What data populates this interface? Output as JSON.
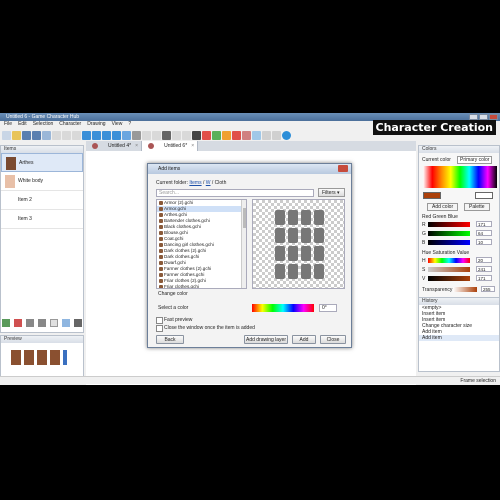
{
  "window": {
    "title": "Untitled 6 - Game Character Hub"
  },
  "brand": {
    "title": "Character Creation"
  },
  "menu": [
    "File",
    "Edit",
    "Selection",
    "Character",
    "Drawing",
    "View",
    "?"
  ],
  "items_panel": {
    "title": "Items",
    "items": [
      {
        "label": "Arthes"
      },
      {
        "label": "White body"
      },
      {
        "label": "Item 2"
      },
      {
        "label": "Item 3"
      }
    ]
  },
  "preview_panel": {
    "title": "Preview"
  },
  "tabs": [
    {
      "label": "Untitled 4*"
    },
    {
      "label": "Untitled 6*"
    }
  ],
  "dialog": {
    "title": "Add items",
    "folder_label": "Current folder:",
    "folder_path": [
      "Items",
      "W",
      "Cloth"
    ],
    "search_placeholder": "Search...",
    "filters_label": "Filters",
    "files": [
      "Armor (2).gchi",
      "Armor.gchi",
      "Arthes.gchi",
      "Bartender clothes.gchi",
      "Black clothes.gchi",
      "Blouse.gchi",
      "Coat.gchi",
      "Dancing girl clothes.gchi",
      "Dark clothes (2).gchi",
      "Dark clothes.gchi",
      "Dwarf.gchi",
      "Farmer clothes (2).gchi",
      "Farmer clothes.gchi",
      "Friar clothes (2).gchi",
      "Friar clothes.gchi"
    ],
    "selected_file_index": 1,
    "change_color": "Change color",
    "select_color": "Select a color",
    "hue_value": "0°",
    "fast_preview": "Fast preview",
    "close_window": "Close the window once the item is added",
    "back": "Back",
    "add_drawing_layer": "Add drawing layer",
    "add": "Add",
    "close": "Close"
  },
  "colors_panel": {
    "title": "Colors",
    "current_color": "Current color",
    "primary_color": "Primary color",
    "add_color": "Add color",
    "palette": "Palette",
    "rgb_title": "Red Green Blue",
    "rgb": [
      {
        "label": "R",
        "value": "171"
      },
      {
        "label": "G",
        "value": "64"
      },
      {
        "label": "B",
        "value": "10"
      }
    ],
    "hsv_title": "Hue Saturation Value",
    "hsv": [
      {
        "label": "H",
        "value": "20"
      },
      {
        "label": "S",
        "value": "241"
      },
      {
        "label": "V",
        "value": "171"
      }
    ],
    "transparency_label": "Transparency",
    "transparency_value": "255",
    "current_hex": "#ab400a"
  },
  "history_panel": {
    "title": "History",
    "items": [
      "<empty>",
      "Insert item",
      "Insert item",
      "Change character size",
      "Add item",
      "Add item"
    ]
  },
  "status": {
    "text": "Frame selection"
  }
}
